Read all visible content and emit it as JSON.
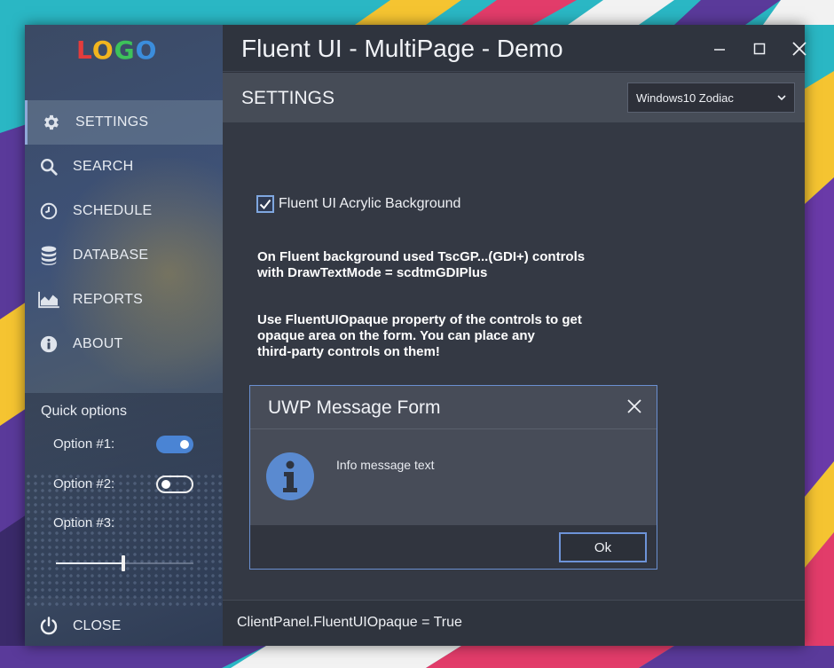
{
  "window": {
    "title": "Fluent UI - MultiPage - Demo"
  },
  "sidebar": {
    "logo": [
      "L",
      "O",
      "G",
      "O"
    ],
    "items": [
      {
        "label": "SETTINGS",
        "icon": "gear-icon",
        "active": true
      },
      {
        "label": "SEARCH",
        "icon": "search-icon",
        "active": false
      },
      {
        "label": "SCHEDULE",
        "icon": "clock-icon",
        "active": false
      },
      {
        "label": "DATABASE",
        "icon": "database-icon",
        "active": false
      },
      {
        "label": "REPORTS",
        "icon": "area-chart-icon",
        "active": false
      },
      {
        "label": "ABOUT",
        "icon": "info-icon",
        "active": false
      }
    ],
    "quick_options": {
      "title": "Quick options",
      "option1": {
        "label": "Option #1:",
        "on": true
      },
      "option2": {
        "label": "Option #2:",
        "on": false
      },
      "option3": {
        "label": "Option #3:",
        "value": 0.48
      }
    },
    "close_label": "CLOSE"
  },
  "header": {
    "title": "SETTINGS",
    "theme_select": "Windows10 Zodiac"
  },
  "content": {
    "checkbox_label": "Fluent UI Acrylic Background",
    "checkbox_checked": true,
    "para1_line1": "On Fluent background used TscGP...(GDI+) controls",
    "para1_line2": "with DrawTextMode = scdtmGDIPlus",
    "para2_line1": "Use FluentUIOpaque property of the controls to get",
    "para2_line2": "opaque area on the form. You can place any",
    "para2_line3": "third-party controls on them!"
  },
  "dialog": {
    "title": "UWP Message Form",
    "message": "Info message text",
    "ok_label": "Ok"
  },
  "status": {
    "text": "ClientPanel.FluentUIOpaque = True"
  },
  "colors": {
    "accent": "#4a84d4",
    "dialog_border": "#6a8fd0"
  }
}
